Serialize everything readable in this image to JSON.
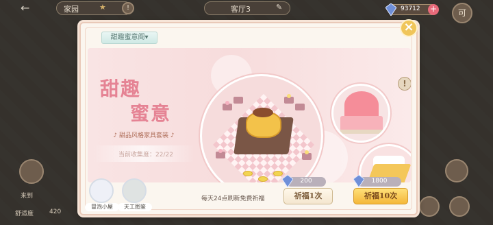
{
  "topbar": {
    "left_label": "家园",
    "center_label": "客厅3",
    "currency_value": "93712",
    "currency_plus": "+",
    "right_label": "可"
  },
  "modal": {
    "tab_select_label": "甜趣蜜意阁▾",
    "close_label": "×",
    "title_line1": "甜趣",
    "title_line2": "蜜意",
    "subtitle": "♪ 甜品风格家具套装 ♪",
    "progress_text": "当前收集度：22/22",
    "info_label": "!",
    "refresh_note": "每天24点刷新免费祈福",
    "cost_single": "200",
    "cost_ten": "1800",
    "pray_single_label": "祈福1次",
    "pray_ten_label": "祈福10次"
  },
  "characters": [
    {
      "name": "冒泡小屋"
    },
    {
      "name": "天工图鉴"
    }
  ],
  "left_hud": {
    "label1": "来到",
    "label2": "舒适度",
    "value2": "420"
  },
  "colors": {
    "title_pink": "#e58394",
    "gold_button": "#f4b73a",
    "close_gold": "#f0c55a",
    "gem_blue": "#6f8fd8"
  }
}
